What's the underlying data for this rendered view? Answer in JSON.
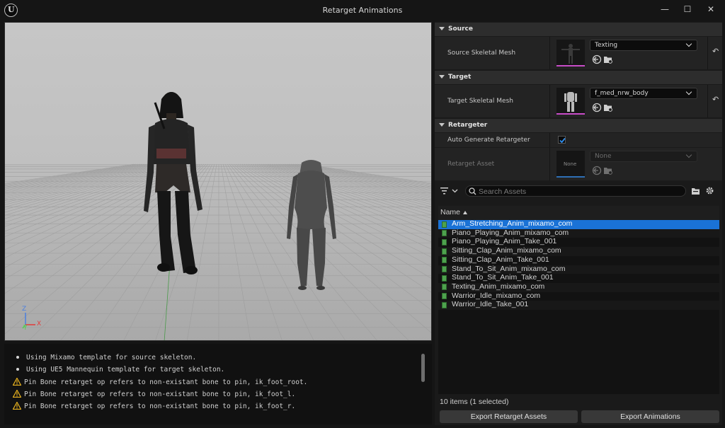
{
  "window": {
    "title": "Retarget Animations",
    "logo_glyph": "U",
    "controls": {
      "minimize": "—",
      "maximize": "☐",
      "close": "✕"
    }
  },
  "viewport": {
    "axes": {
      "z": "Z",
      "y": "Y",
      "x": "X"
    },
    "colors": {
      "x": "#e23a3a",
      "y": "#4fd04f",
      "z": "#4a7fe0"
    }
  },
  "log": {
    "lines": [
      {
        "type": "info",
        "text": "Using Mixamo template for source skeleton."
      },
      {
        "type": "info",
        "text": "Using UE5 Mannequin template for target skeleton."
      },
      {
        "type": "warning",
        "text": "Pin Bone retarget op refers to non-existant bone to pin, ik_foot_root."
      },
      {
        "type": "warning",
        "text": "Pin Bone retarget op refers to non-existant bone to pin, ik_foot_l."
      },
      {
        "type": "warning",
        "text": "Pin Bone retarget op refers to non-existant bone to pin, ik_foot_r."
      }
    ]
  },
  "details": {
    "source": {
      "header": "Source",
      "label": "Source Skeletal Mesh",
      "value": "Texting"
    },
    "target": {
      "header": "Target",
      "label": "Target Skeletal Mesh",
      "value": "f_med_nrw_body"
    },
    "retargeter": {
      "header": "Retargeter",
      "auto_label": "Auto Generate Retargeter",
      "auto_checked": true,
      "asset_label": "Retarget Asset",
      "asset_thumb": "None",
      "asset_value": "None"
    },
    "reset_glyph": "↶"
  },
  "browser": {
    "search_placeholder": "Search Assets",
    "column_name": "Name",
    "items": [
      "Arm_Stretching_Anim_mixamo_com",
      "Piano_Playing_Anim_mixamo_com",
      "Piano_Playing_Anim_Take_001",
      "Sitting_Clap_Anim_mixamo_com",
      "Sitting_Clap_Anim_Take_001",
      "Stand_To_Sit_Anim_mixamo_com",
      "Stand_To_Sit_Anim_Take_001",
      "Texting_Anim_mixamo_com",
      "Warrior_Idle_mixamo_com",
      "Warrior_Idle_Take_001"
    ],
    "selected_index": 0,
    "status": "10 items (1 selected)",
    "export_assets_label": "Export Retarget Assets",
    "export_animations_label": "Export Animations"
  },
  "colors": {
    "selection": "#1a72d6",
    "thumb_underline": "#c84cc8",
    "warning": "#e8b21f",
    "anim_icon": "#4ea24e"
  }
}
